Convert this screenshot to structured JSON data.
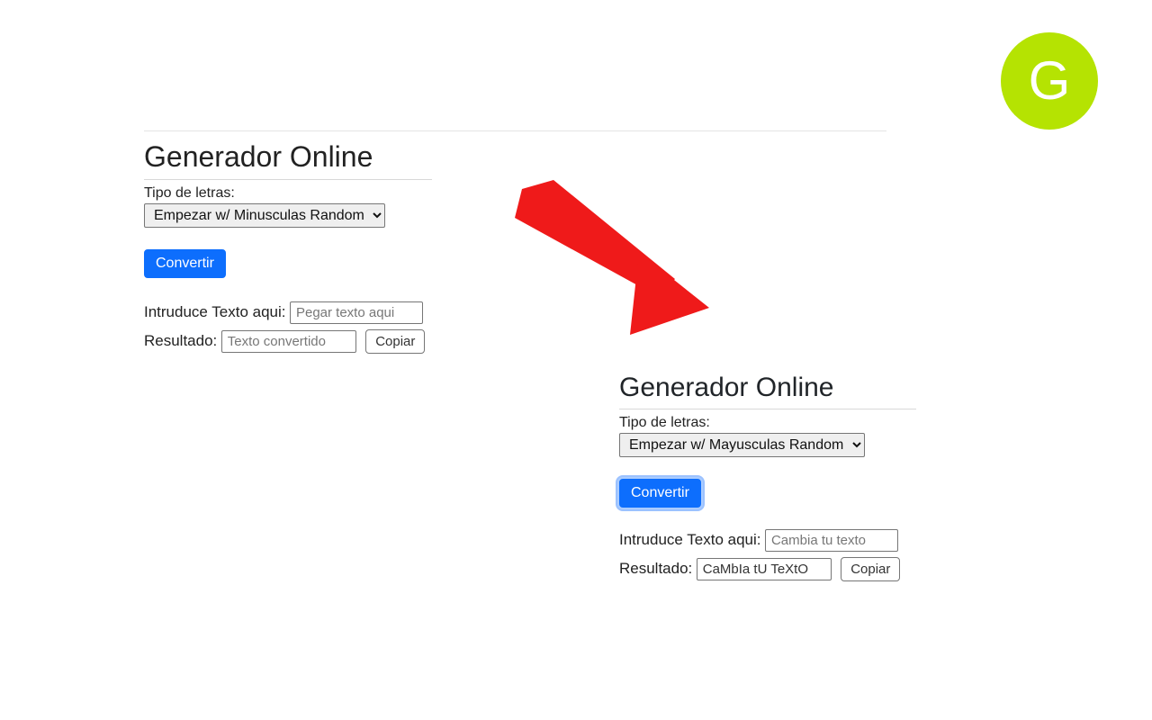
{
  "avatar": {
    "initial": "G",
    "bg": "#b5e302"
  },
  "arrow_color": "#ef1a1a",
  "panel1": {
    "title": "Generador Online",
    "type_label": "Tipo de letras:",
    "select_value": "Empezar w/ Minusculas Random",
    "convert_label": "Convertir",
    "input_label": "Intruduce Texto aqui:",
    "input_placeholder": "Pegar texto aqui",
    "input_value": "",
    "result_label": "Resultado:",
    "result_placeholder": "Texto convertido",
    "result_value": "",
    "copy_label": "Copiar"
  },
  "panel2": {
    "title": "Generador Online",
    "type_label": "Tipo de letras:",
    "select_value": "Empezar w/ Mayusculas Random",
    "convert_label": "Convertir",
    "input_label": "Intruduce Texto aqui:",
    "input_placeholder": "Cambia tu texto",
    "input_value": "",
    "result_label": "Resultado:",
    "result_placeholder": "",
    "result_value": "CaMbIa tU TeXtO",
    "copy_label": "Copiar"
  }
}
